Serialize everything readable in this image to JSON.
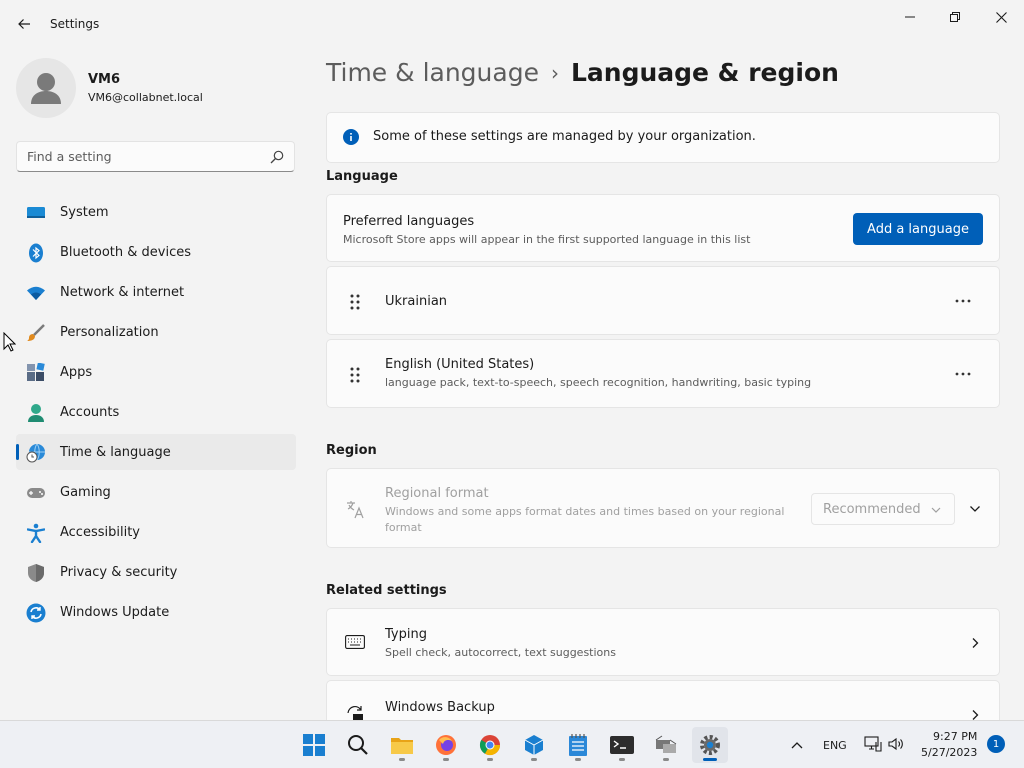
{
  "window": {
    "title": "Settings"
  },
  "profile": {
    "name": "VM6",
    "email": "VM6@collabnet.local"
  },
  "search": {
    "placeholder": "Find a setting",
    "value": ""
  },
  "sidebar": {
    "items": [
      {
        "label": "System",
        "icon": "monitor-icon"
      },
      {
        "label": "Bluetooth & devices",
        "icon": "bluetooth-icon"
      },
      {
        "label": "Network & internet",
        "icon": "wifi-icon"
      },
      {
        "label": "Personalization",
        "icon": "paintbrush-icon"
      },
      {
        "label": "Apps",
        "icon": "apps-icon"
      },
      {
        "label": "Accounts",
        "icon": "person-icon"
      },
      {
        "label": "Time & language",
        "icon": "globe-clock-icon",
        "active": true
      },
      {
        "label": "Gaming",
        "icon": "gamepad-icon"
      },
      {
        "label": "Accessibility",
        "icon": "accessibility-icon"
      },
      {
        "label": "Privacy & security",
        "icon": "shield-icon"
      },
      {
        "label": "Windows Update",
        "icon": "update-icon"
      }
    ]
  },
  "breadcrumb": {
    "parent": "Time & language",
    "separator": "›",
    "current": "Language & region"
  },
  "notice": {
    "text": "Some of these settings are managed by your organization."
  },
  "language": {
    "section_label": "Language",
    "preferred": {
      "title": "Preferred languages",
      "subtitle": "Microsoft Store apps will appear in the first supported language in this list",
      "button": "Add a language"
    },
    "items": [
      {
        "name": "Ukrainian",
        "details": ""
      },
      {
        "name": "English (United States)",
        "details": "language pack, text-to-speech, speech recognition, handwriting, basic typing"
      }
    ]
  },
  "region": {
    "section_label": "Region",
    "regional_format": {
      "title": "Regional format",
      "subtitle": "Windows and some apps format dates and times based on your regional format",
      "value": "Recommended"
    }
  },
  "related": {
    "section_label": "Related settings",
    "items": [
      {
        "title": "Typing",
        "subtitle": "Spell check, autocorrect, text suggestions",
        "icon": "keyboard-icon"
      },
      {
        "title": "Windows Backup",
        "subtitle": "",
        "icon": "backup-icon"
      }
    ]
  },
  "taskbar": {
    "language": "ENG",
    "time": "9:27 PM",
    "date": "5/27/2023",
    "notifications": "1"
  },
  "colors": {
    "accent": "#005fb8",
    "background": "#f3f3f3",
    "card": "#fbfbfb"
  }
}
